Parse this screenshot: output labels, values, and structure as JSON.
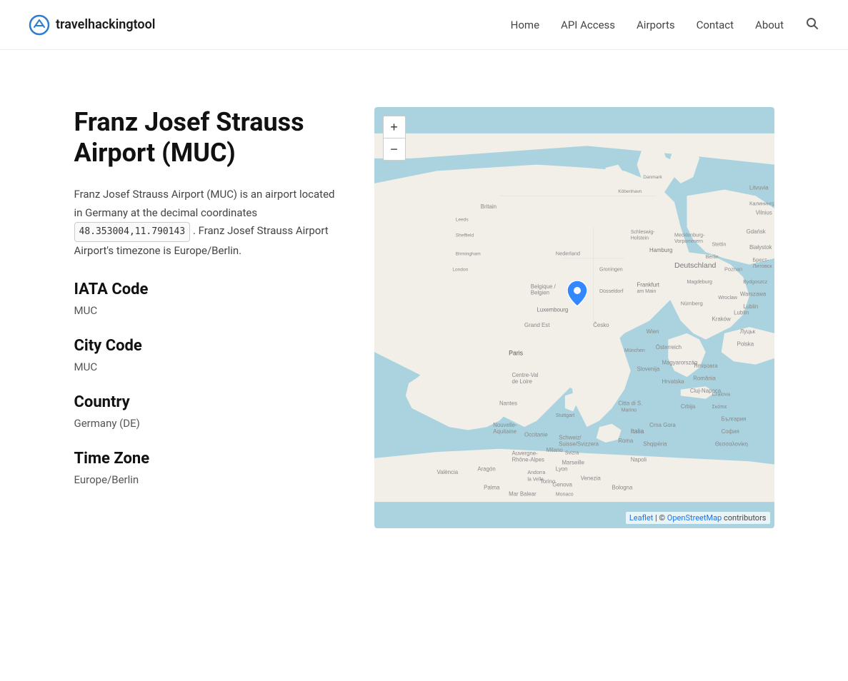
{
  "site": {
    "logo_text": "travelhackingtool",
    "logo_icon": "✈"
  },
  "nav": {
    "links": [
      {
        "label": "Home",
        "href": "#"
      },
      {
        "label": "API Access",
        "href": "#"
      },
      {
        "label": "Airports",
        "href": "#"
      },
      {
        "label": "Contact",
        "href": "#"
      },
      {
        "label": "About",
        "href": "#"
      }
    ]
  },
  "airport": {
    "title": "Franz Josef Strauss Airport (MUC)",
    "description_1": "Franz Josef Strauss Airport (MUC) is an airport located in Germany at the decimal coordinates",
    "coordinates": "48.353004,11.790143",
    "description_2": ". Franz Josef Strauss Airport Airport's timezone is Europe/Berlin.",
    "iata_label": "IATA Code",
    "iata_value": "MUC",
    "city_code_label": "City Code",
    "city_code_value": "MUC",
    "country_label": "Country",
    "country_value": "Germany (DE)",
    "timezone_label": "Time Zone",
    "timezone_value": "Europe/Berlin"
  },
  "map": {
    "zoom_in": "+",
    "zoom_out": "−",
    "attribution_leaflet": "Leaflet",
    "attribution_osm": "OpenStreetMap",
    "attribution_suffix": "contributors"
  }
}
